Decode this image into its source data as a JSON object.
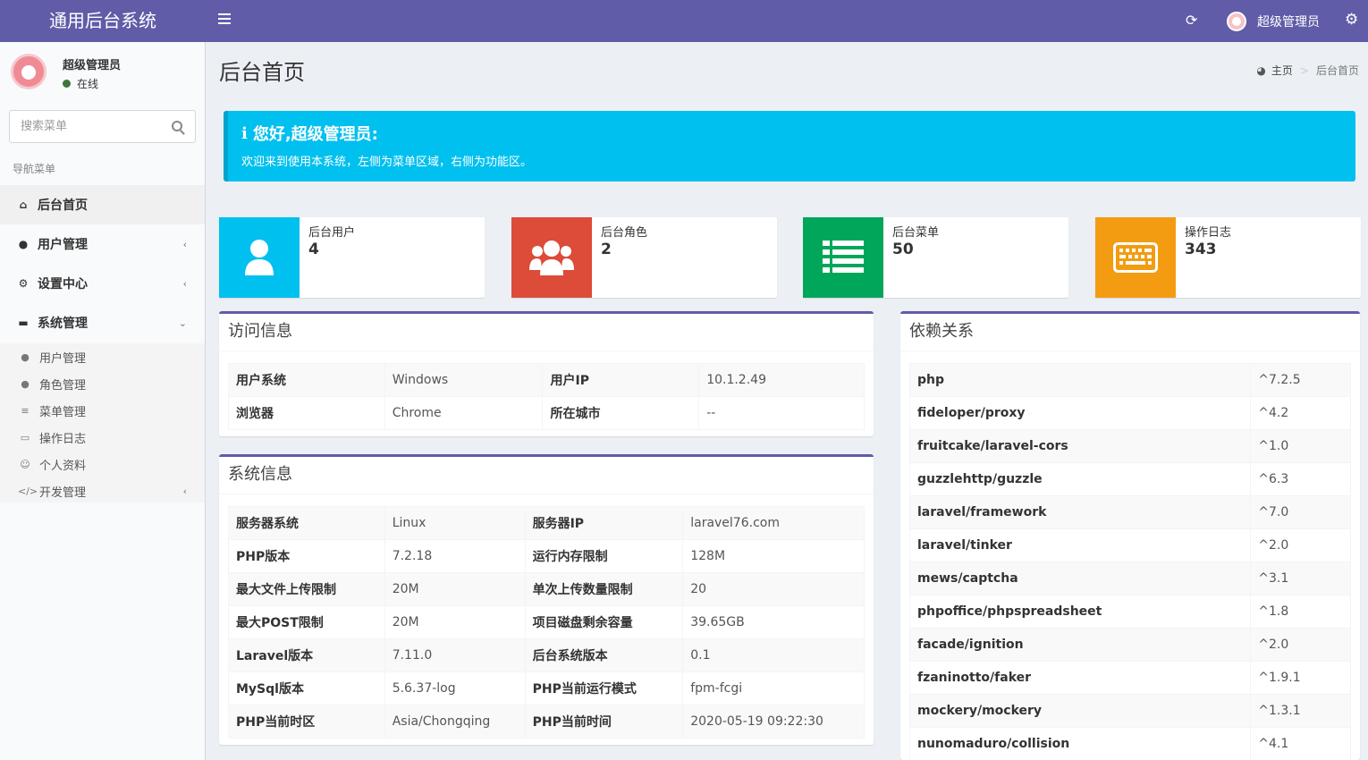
{
  "brand": "通用后台系统",
  "topbar": {
    "user_name": "超级管理员"
  },
  "sidebar": {
    "user_name": "超级管理员",
    "status": "在线",
    "search_placeholder": "搜索菜单",
    "nav_header": "导航菜单",
    "items": [
      {
        "label": "后台首页",
        "icon": "home-icon"
      },
      {
        "label": "用户管理",
        "icon": "users-icon"
      },
      {
        "label": "设置中心",
        "icon": "cogs-icon"
      },
      {
        "label": "系统管理",
        "icon": "desktop-icon"
      }
    ],
    "sub_items": [
      {
        "label": "用户管理",
        "icon": "user-icon"
      },
      {
        "label": "角色管理",
        "icon": "users-icon"
      },
      {
        "label": "菜单管理",
        "icon": "bars-icon"
      },
      {
        "label": "操作日志",
        "icon": "keyboard-icon"
      },
      {
        "label": "个人资料",
        "icon": "smile-icon"
      },
      {
        "label": "开发管理",
        "icon": "code-icon"
      }
    ]
  },
  "page": {
    "title": "后台首页",
    "breadcrumb_home": "主页",
    "breadcrumb_current": "后台首页"
  },
  "callout": {
    "title": "您好,超级管理员:",
    "text": "欢迎来到使用本系统，左侧为菜单区域，右侧为功能区。"
  },
  "stats": [
    {
      "label": "后台用户",
      "value": "4",
      "color": "#00c0ef",
      "icon": "user-icon"
    },
    {
      "label": "后台角色",
      "value": "2",
      "color": "#dd4b39",
      "icon": "users-icon"
    },
    {
      "label": "后台菜单",
      "value": "50",
      "color": "#00a65a",
      "icon": "list-icon"
    },
    {
      "label": "操作日志",
      "value": "343",
      "color": "#f39c12",
      "icon": "keyboard-icon"
    }
  ],
  "visit": {
    "title": "访问信息",
    "rows": [
      [
        "用户系统",
        "Windows",
        "用户IP",
        "10.1.2.49"
      ],
      [
        "浏览器",
        "Chrome",
        "所在城市",
        "--"
      ]
    ]
  },
  "system": {
    "title": "系统信息",
    "rows": [
      [
        "服务器系统",
        "Linux",
        "服务器IP",
        "laravel76.com"
      ],
      [
        "PHP版本",
        "7.2.18",
        "运行内存限制",
        "128M"
      ],
      [
        "最大文件上传限制",
        "20M",
        "单次上传数量限制",
        "20"
      ],
      [
        "最大POST限制",
        "20M",
        "项目磁盘剩余容量",
        "39.65GB"
      ],
      [
        "Laravel版本",
        "7.11.0",
        "后台系统版本",
        "0.1"
      ],
      [
        "MySql版本",
        "5.6.37-log",
        "PHP当前运行模式",
        "fpm-fcgi"
      ],
      [
        "PHP当前时区",
        "Asia/Chongqing",
        "PHP当前时间",
        "2020-05-19 09:22:30"
      ]
    ]
  },
  "deps": {
    "title": "依赖关系",
    "rows": [
      [
        "php",
        "^7.2.5"
      ],
      [
        "fideloper/proxy",
        "^4.2"
      ],
      [
        "fruitcake/laravel-cors",
        "^1.0"
      ],
      [
        "guzzlehttp/guzzle",
        "^6.3"
      ],
      [
        "laravel/framework",
        "^7.0"
      ],
      [
        "laravel/tinker",
        "^2.0"
      ],
      [
        "mews/captcha",
        "^3.1"
      ],
      [
        "phpoffice/phpspreadsheet",
        "^1.8"
      ],
      [
        "facade/ignition",
        "^2.0"
      ],
      [
        "fzaninotto/faker",
        "^1.9.1"
      ],
      [
        "mockery/mockery",
        "^1.3.1"
      ],
      [
        "nunomaduro/collision",
        "^4.1"
      ]
    ]
  }
}
